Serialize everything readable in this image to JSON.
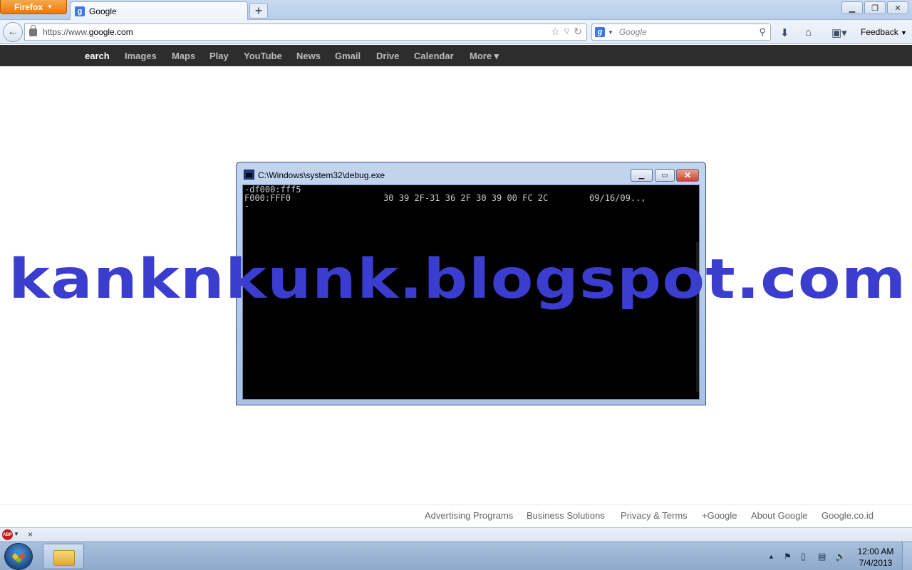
{
  "browser": {
    "firefox_button": "Firefox",
    "tab_title": "Google",
    "new_tab": "+",
    "url_scheme": "https://www.",
    "url_host": "google.com",
    "search_engine_placeholder": "Google",
    "feedback_label": "Feedback"
  },
  "google_bar": {
    "items": [
      "earch",
      "Images",
      "Maps",
      "Play",
      "YouTube",
      "News",
      "Gmail",
      "Drive",
      "Calendar",
      "More ▾"
    ]
  },
  "console": {
    "title": "C:\\Windows\\system32\\debug.exe",
    "lines": [
      "-df000:fff5",
      "F000:FFF0                  30 39 2F-31 36 2F 30 39 00 FC 2C        09/16/09..,",
      "-"
    ]
  },
  "watermark": "kanknkunk.blogspot.com",
  "footer": {
    "links": [
      "Advertising Programs",
      "Business Solutions",
      "Privacy & Terms",
      "+Google",
      "About Google",
      "Google.co.id"
    ]
  },
  "addon_bar": {
    "abp_label": "ABP",
    "close": "×"
  },
  "taskbar": {
    "time": "12:00 AM",
    "date": "7/4/2013"
  }
}
